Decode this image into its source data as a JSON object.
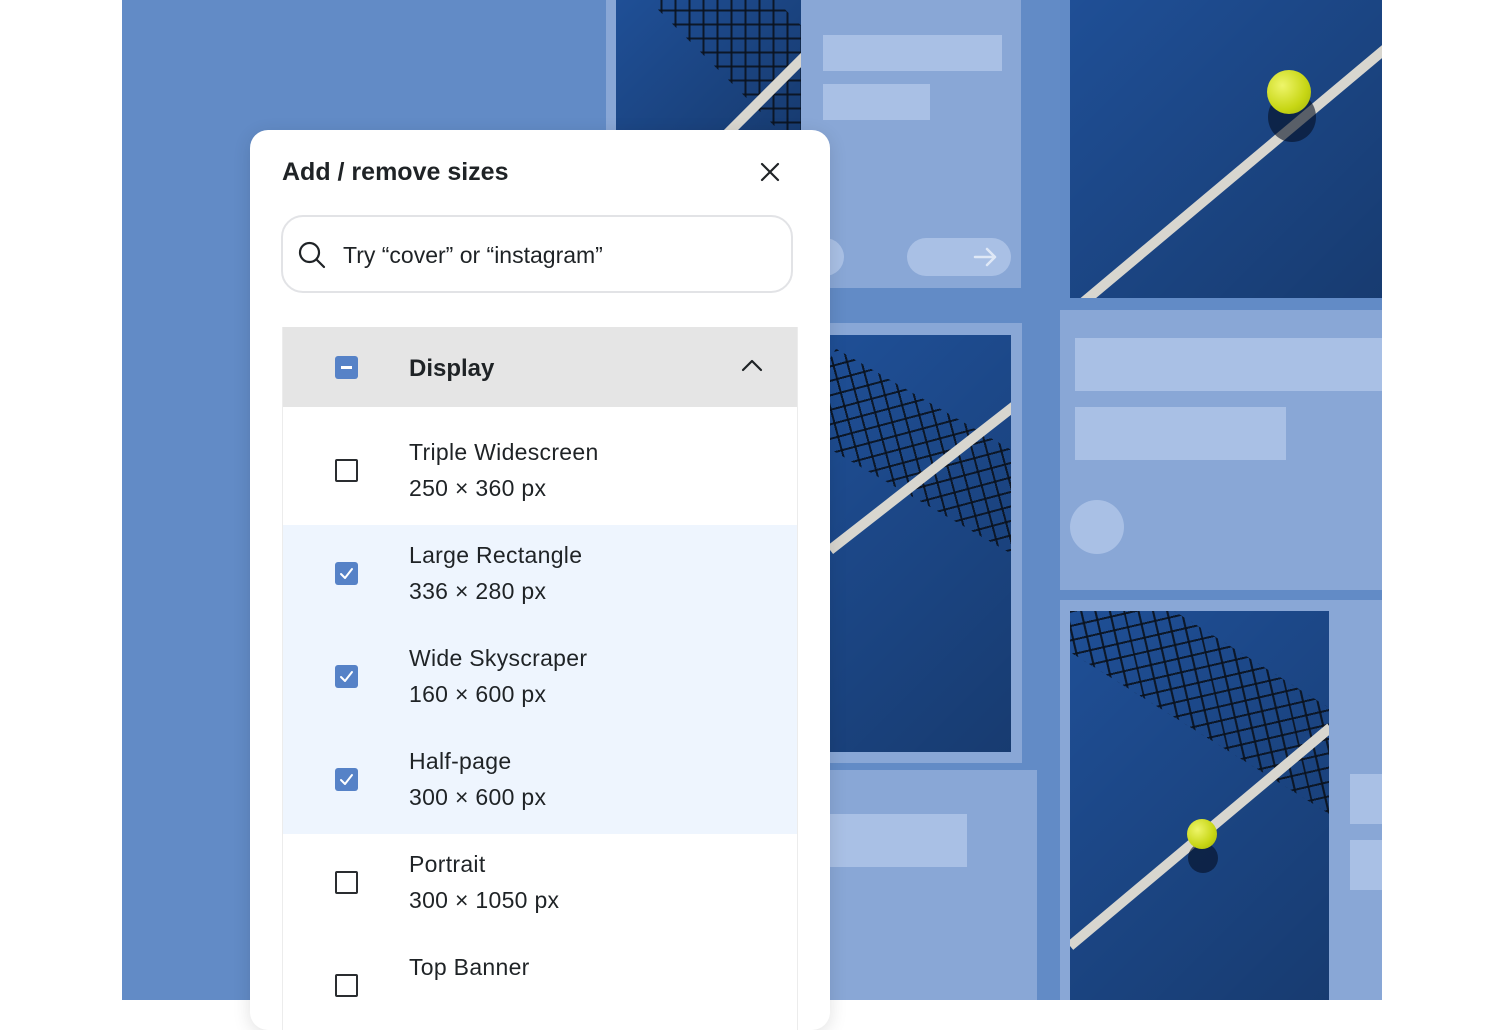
{
  "modal": {
    "title": "Add / remove sizes",
    "search_placeholder": "Try “cover” or “instagram”"
  },
  "group": {
    "label": "Display",
    "state": "partial",
    "expanded": true
  },
  "items": [
    {
      "name": "Triple Widescreen",
      "size": "250 × 360 px",
      "checked": false
    },
    {
      "name": "Large Rectangle",
      "size": "336 × 280 px",
      "checked": true
    },
    {
      "name": "Wide Skyscraper",
      "size": "160 × 600 px",
      "checked": true
    },
    {
      "name": "Half-page",
      "size": "300 × 600 px",
      "checked": true
    },
    {
      "name": "Portrait",
      "size": "300 × 1050 px",
      "checked": false
    },
    {
      "name": "Top Banner",
      "size": "",
      "checked": false
    }
  ],
  "icons": {
    "close": "close-icon",
    "search": "search-icon",
    "collapse": "chevron-up-icon",
    "arrow": "arrow-right-icon"
  },
  "colors": {
    "background": "#628bc6",
    "panel": "#89a7d6",
    "placeholder": "#a9c0e5",
    "accent": "#5682c7",
    "checked_row": "#eef5fe",
    "court": "#1f4f96",
    "ball": "#c7d614"
  }
}
